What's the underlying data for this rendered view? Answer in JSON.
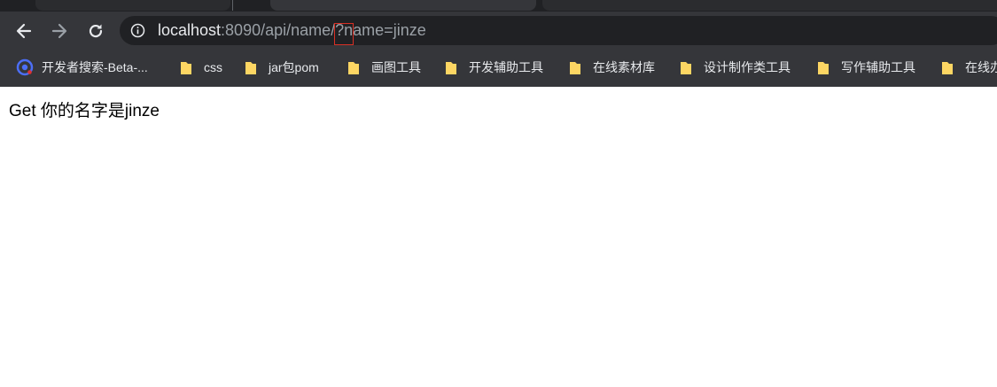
{
  "browser": {
    "address": {
      "host": "localhost",
      "path_before_marker": ":8090/api/name/",
      "path_marker": "?",
      "query": "name=jinze"
    },
    "bookmarks": [
      {
        "label": "开发者搜索-Beta-...",
        "icon": "search-engine-icon"
      },
      {
        "label": "css",
        "icon": "folder-icon"
      },
      {
        "label": "jar包pom",
        "icon": "folder-icon"
      },
      {
        "label": "画图工具",
        "icon": "folder-icon"
      },
      {
        "label": "开发辅助工具",
        "icon": "folder-icon"
      },
      {
        "label": "在线素材库",
        "icon": "folder-icon"
      },
      {
        "label": "设计制作类工具",
        "icon": "folder-icon"
      },
      {
        "label": "写作辅助工具",
        "icon": "folder-icon"
      },
      {
        "label": "在线办",
        "icon": "folder-icon"
      }
    ],
    "colors": {
      "chrome": "#35363a",
      "omnibox": "#202124",
      "highlight": "#d93025",
      "folder": "#fdd663"
    }
  },
  "page": {
    "text": "Get 你的名字是jinze"
  }
}
